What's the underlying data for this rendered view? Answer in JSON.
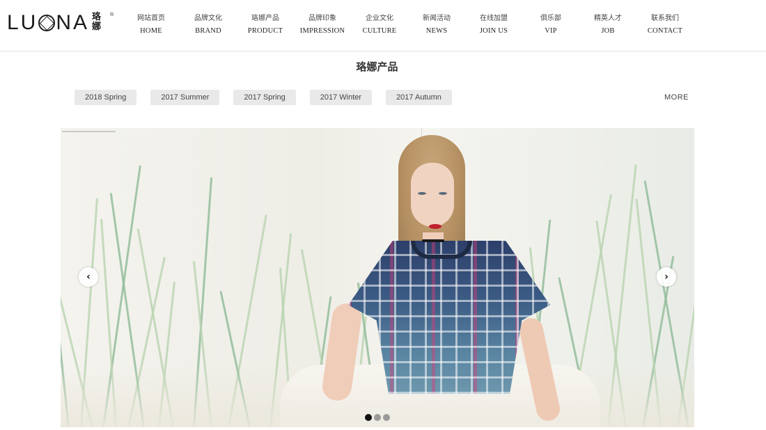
{
  "logo": {
    "text_left": "LU",
    "text_right": "NA",
    "cn_line1": "珞",
    "cn_line2": "娜",
    "reg": "®"
  },
  "nav": [
    {
      "cn": "网站首页",
      "en": "HOME"
    },
    {
      "cn": "品牌文化",
      "en": "BRAND"
    },
    {
      "cn": "珞娜产品",
      "en": "PRODUCT"
    },
    {
      "cn": "品牌印象",
      "en": "IMPRESSION"
    },
    {
      "cn": "企业文化",
      "en": "CULTURE"
    },
    {
      "cn": "新闻活动",
      "en": "NEWS"
    },
    {
      "cn": "在线加盟",
      "en": "JOIN US"
    },
    {
      "cn": "俱乐部",
      "en": "VIP"
    },
    {
      "cn": "精英人才",
      "en": "JOB"
    },
    {
      "cn": "联系我们",
      "en": "CONTACT"
    }
  ],
  "section": {
    "title": "珞娜产品"
  },
  "tabs": [
    "2018 Spring",
    "2017 Summer",
    "2017 Spring",
    "2017 Winter",
    "2017 Autumn"
  ],
  "more_label": "MORE",
  "carousel": {
    "prev_icon": "‹",
    "next_icon": "›",
    "slide_count": 3,
    "active_slide": 1
  },
  "colors": {
    "accent": "#111111",
    "tab_bg": "#e9e9e9",
    "divider": "#e3e3e3"
  }
}
